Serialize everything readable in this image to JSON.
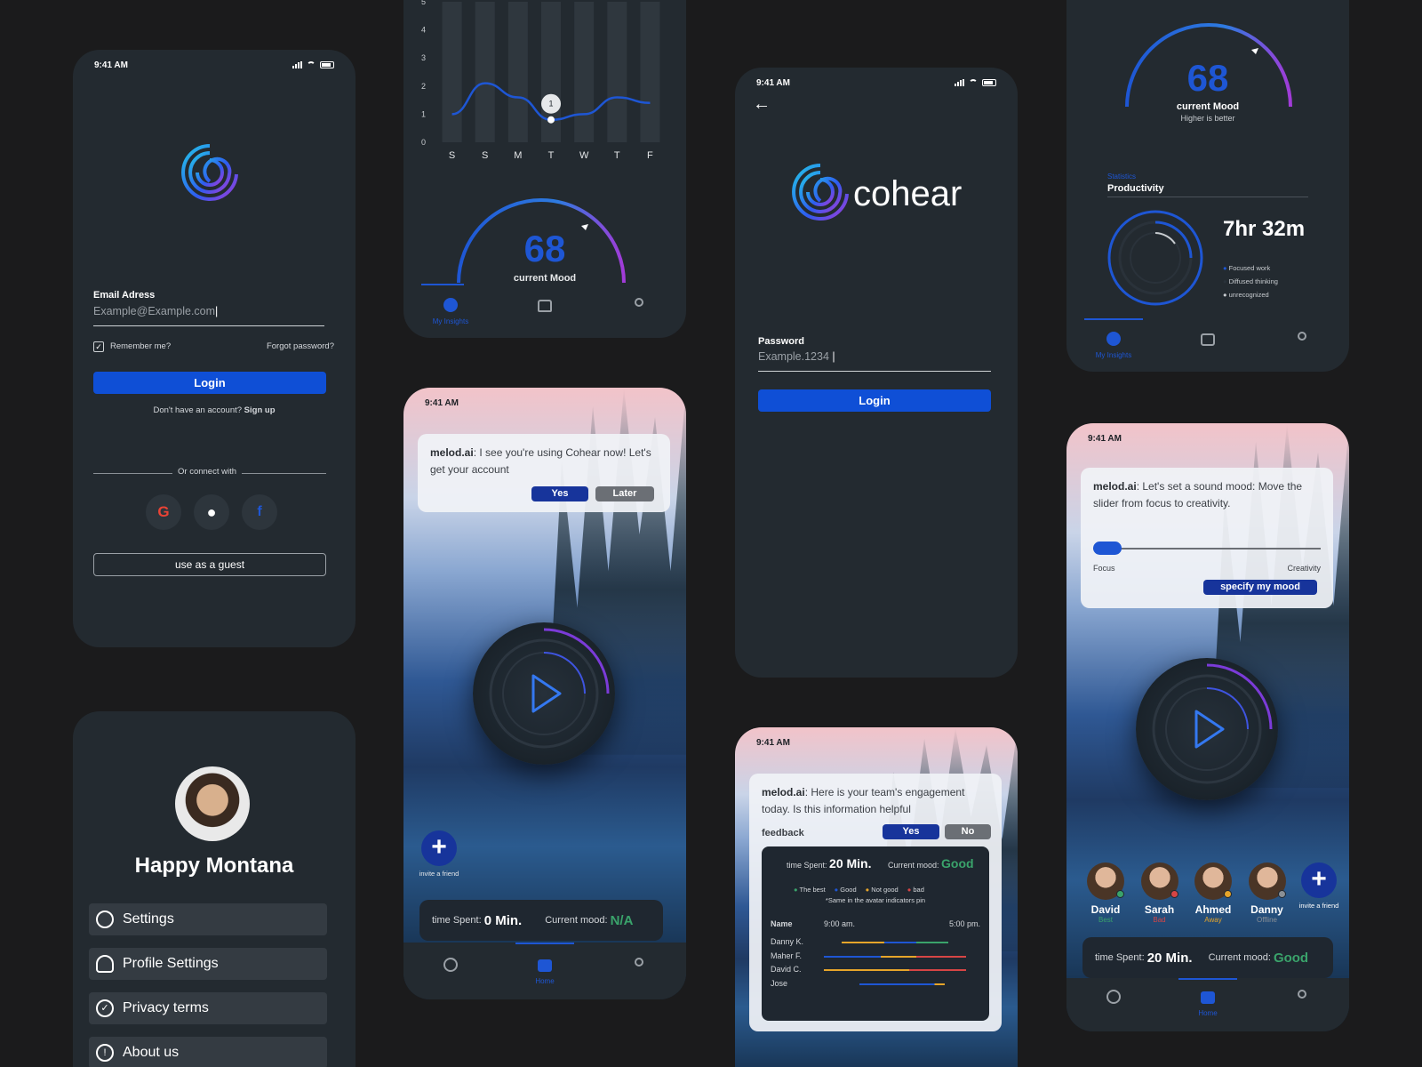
{
  "status_time": "9:41 AM",
  "brand": {
    "name": "cohear"
  },
  "login": {
    "email_label": "Email Adress",
    "email_placeholder": "Example@Example.com",
    "remember": "Remember me?",
    "forgot": "Forgot password?",
    "login_btn": "Login",
    "no_account": "Don't have an account?",
    "sign_up": "Sign up",
    "or_connect": "Or connect with",
    "guest": "use as a guest"
  },
  "password_screen": {
    "password_label": "Password",
    "password_placeholder": "Example.1234",
    "login_btn": "Login"
  },
  "chart_data": {
    "type": "bar",
    "categories": [
      "S",
      "S",
      "M",
      "T",
      "W",
      "T",
      "F"
    ],
    "y_ticks": [
      "0",
      "1",
      "2",
      "3",
      "4",
      "5"
    ],
    "ylim": [
      0,
      5
    ],
    "line_values": [
      1.0,
      2.1,
      1.6,
      0.8,
      1.0,
      1.6,
      1.4
    ],
    "marker_label": "1"
  },
  "mood": {
    "value": "68",
    "label": "current Mood",
    "sub": "Higher is better"
  },
  "nav": {
    "insights": "My Insights",
    "home": "Home"
  },
  "productivity": {
    "overline": "Statistics",
    "title": "Productivity",
    "time": "7hr 32m",
    "legend": [
      "Focused work",
      "Diffused thinking",
      "unrecognized"
    ]
  },
  "chat1": {
    "speaker": "melod.ai",
    "text": ": I see you're using Cohear now! Let's get your account",
    "yes": "Yes",
    "later": "Later"
  },
  "chat2": {
    "speaker": "melod.ai",
    "text": ": Let's set a sound mood: Move the slider from focus to creativity.",
    "left": "Focus",
    "right": "Creativity",
    "btn": "specify my mood"
  },
  "chat3": {
    "speaker": "melod.ai",
    "text": ": Here is your team's engagement today. Is this information helpful",
    "feedback": "feedback",
    "yes": "Yes",
    "no": "No"
  },
  "engagement": {
    "time_label": "time Spent:",
    "time_value": "20 Min.",
    "mood_label": "Current mood:",
    "mood_value": "Good",
    "legend": [
      "The best",
      "Good",
      "Not good",
      "bad"
    ],
    "note": "*Same in the avatar indicators pin",
    "col_name": "Name",
    "col_start": "9:00 am.",
    "col_end": "5:00 pm.",
    "rows": [
      "Danny K.",
      "Maher F.",
      "David C.",
      "Jose"
    ]
  },
  "home1": {
    "invite": "invite a friend",
    "time_label": "time Spent:",
    "time_value": "0 Min.",
    "mood_label": "Current mood:",
    "mood_value": "N/A"
  },
  "home2": {
    "team": [
      {
        "name": "David",
        "status": "Best",
        "color": "#3aa36b"
      },
      {
        "name": "Sarah",
        "status": "Bad",
        "color": "#d64545"
      },
      {
        "name": "Ahmed",
        "status": "Away",
        "color": "#e6a52a"
      },
      {
        "name": "Danny",
        "status": "Offline",
        "color": "#8a9096"
      }
    ],
    "invite": "invite a friend",
    "time_label": "time Spent:",
    "time_value": "20 Min.",
    "mood_label": "Current mood:",
    "mood_value": "Good"
  },
  "profile": {
    "name": "Happy Montana",
    "menu": [
      "Settings",
      "Profile Settings",
      "Privacy terms",
      "About us"
    ]
  },
  "colors": {
    "accent": "#0f4fd6",
    "good": "#3aa36b",
    "bg": "#1b1b1c",
    "card": "#232a30"
  }
}
